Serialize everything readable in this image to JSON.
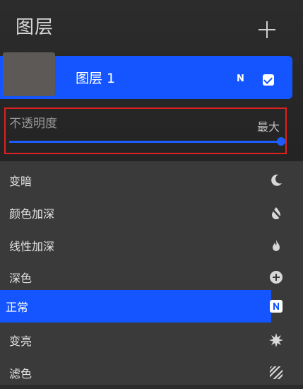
{
  "panel": {
    "title": "图层",
    "add_icon": "plus-icon"
  },
  "layer": {
    "name": "图层 1",
    "blend_mode_letter": "N",
    "visible": true,
    "visibility_icon": "checkbox-icon"
  },
  "opacity": {
    "label": "不透明度",
    "value_text": "最大",
    "value_fraction": 1.0,
    "accent": "#1d5cff"
  },
  "blend_modes": [
    {
      "label": "变暗",
      "icon": "moon-icon",
      "active": false
    },
    {
      "label": "颜色加深",
      "icon": "burn-icon",
      "active": false
    },
    {
      "label": "线性加深",
      "icon": "flame-icon",
      "active": false
    },
    {
      "label": "深色",
      "icon": "plus-circle-icon",
      "active": false
    },
    {
      "label": "正常",
      "icon": "n-badge-icon",
      "active": true
    },
    {
      "label": "变亮",
      "icon": "sun-icon",
      "active": false
    },
    {
      "label": "滤色",
      "icon": "stripes-icon",
      "active": false
    }
  ],
  "colors": {
    "selection": "#1455ff",
    "background": "#242424",
    "list_background": "#3a3a3a"
  }
}
